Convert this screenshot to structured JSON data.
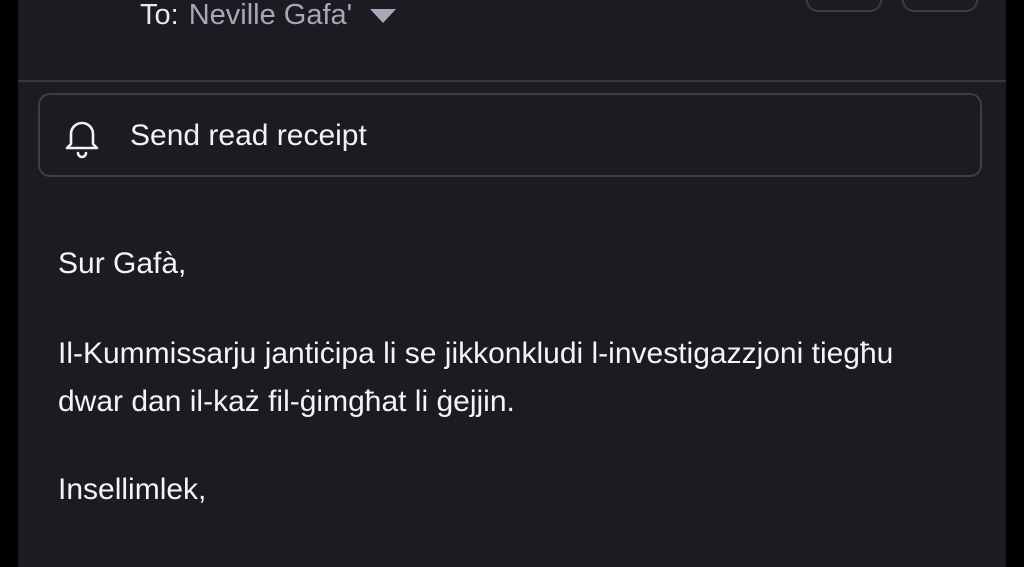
{
  "header": {
    "to_label": "To:",
    "recipient": "Neville Gafa'",
    "recipient_dropdown_icon": "chevron-down-icon"
  },
  "read_receipt": {
    "icon": "bell-icon",
    "label": "Send read receipt"
  },
  "message": {
    "greeting": "Sur Gafà,",
    "paragraph": "Il-Kummissarju jantiċipa li se jikkonkludi l-investigazzjoni tiegħu dwar dan il-każ fil-ġimgħat li ġejjin.",
    "closing": "Insellimlek,"
  },
  "colors": {
    "background": "#1c1b22",
    "text": "#f4f3f8",
    "muted": "#a9a7b7",
    "border": "#3f3e46"
  }
}
